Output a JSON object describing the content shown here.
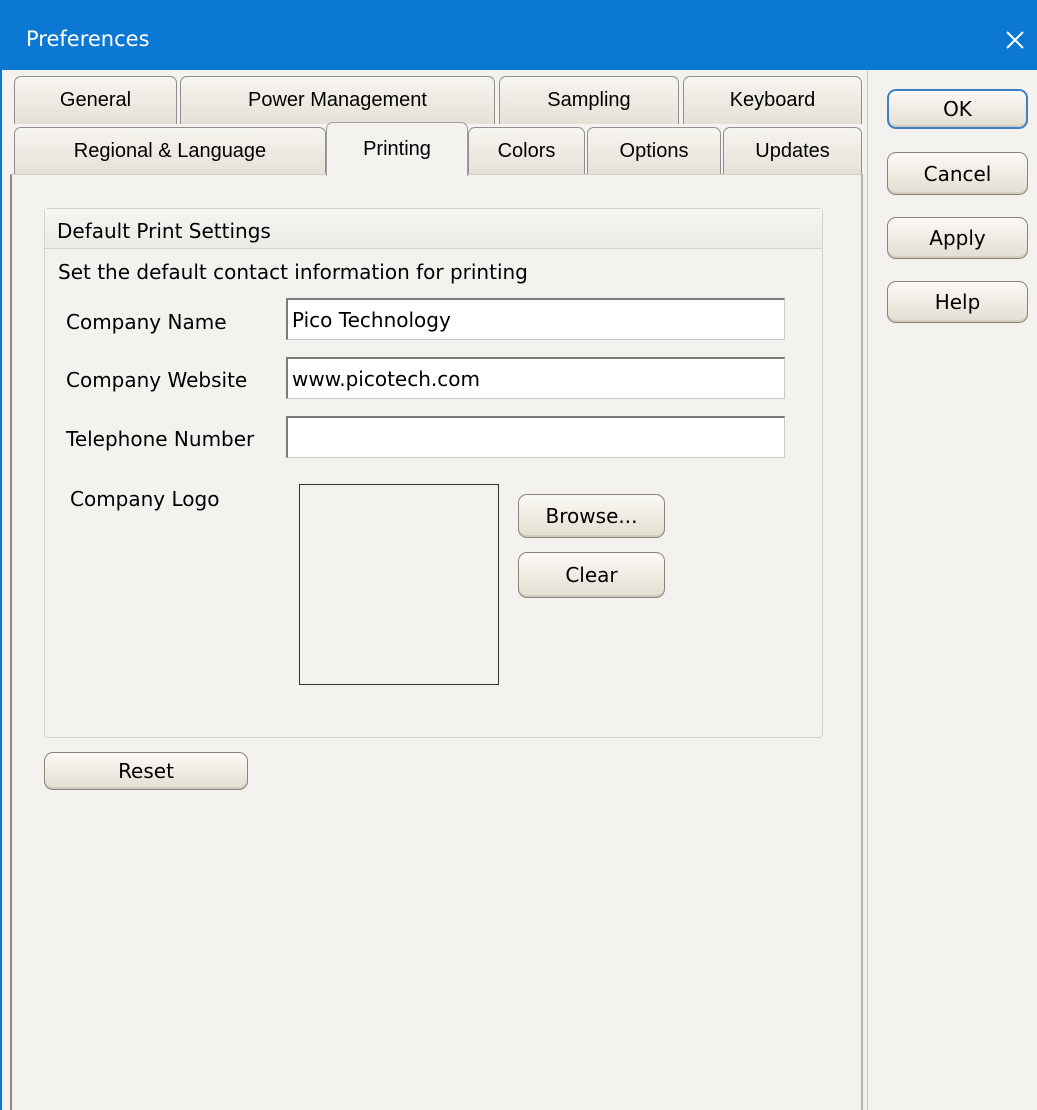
{
  "window": {
    "title": "Preferences"
  },
  "tabs": {
    "row1": [
      "General",
      "Power Management",
      "Sampling",
      "Keyboard"
    ],
    "row2": [
      "Regional & Language",
      "Printing",
      "Colors",
      "Options",
      "Updates"
    ],
    "active": "Printing"
  },
  "dialog_buttons": {
    "ok": "OK",
    "cancel": "Cancel",
    "apply": "Apply",
    "help": "Help"
  },
  "print_settings": {
    "group_title": "Default Print Settings",
    "description": "Set the default contact information for printing",
    "company_name_label": "Company Name",
    "company_name_value": "Pico Technology",
    "company_website_label": "Company Website",
    "company_website_value": "www.picotech.com",
    "telephone_label": "Telephone Number",
    "telephone_value": "",
    "logo_label": "Company Logo",
    "browse_button": "Browse...",
    "clear_button": "Clear"
  },
  "reset_button": "Reset",
  "colors": {
    "titlebar": "#0b78d3",
    "background": "#f4f2ee",
    "default_button_border": "#3e80c8"
  }
}
